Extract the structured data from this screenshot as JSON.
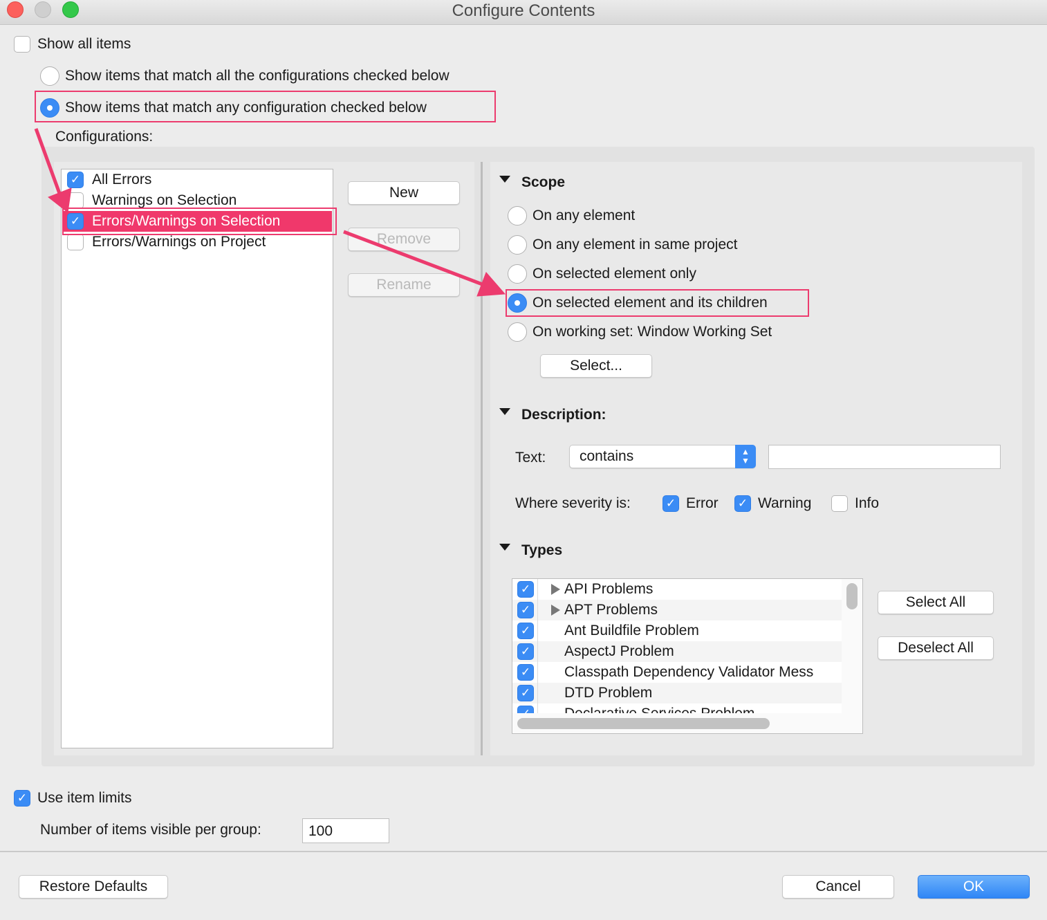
{
  "window": {
    "title": "Configure Contents"
  },
  "show_all": {
    "label": "Show all items",
    "checked": false
  },
  "match_options": [
    {
      "label": "Show items that match all the configurations checked below",
      "selected": false
    },
    {
      "label": "Show items that match any configuration checked below",
      "selected": true
    }
  ],
  "configurations": {
    "label": "Configurations:",
    "items": [
      {
        "label": "All Errors",
        "checked": true,
        "selected": false
      },
      {
        "label": "Warnings on Selection",
        "checked": false,
        "selected": false
      },
      {
        "label": "Errors/Warnings on Selection",
        "checked": true,
        "selected": true
      },
      {
        "label": "Errors/Warnings on Project",
        "checked": false,
        "selected": false
      }
    ],
    "buttons": {
      "new": "New",
      "remove": "Remove",
      "rename": "Rename"
    }
  },
  "scope": {
    "heading": "Scope",
    "options": [
      {
        "label": "On any element",
        "selected": false
      },
      {
        "label": "On any element in same project",
        "selected": false
      },
      {
        "label": "On selected element only",
        "selected": false
      },
      {
        "label": "On selected element and its children",
        "selected": true
      },
      {
        "label": "On working set:  Window Working Set",
        "selected": false
      }
    ],
    "select_button": "Select..."
  },
  "description": {
    "heading": "Description:",
    "text_label": "Text:",
    "operator": "contains",
    "text_value": "",
    "severity_label": "Where severity is:",
    "severities": [
      {
        "label": "Error",
        "checked": true
      },
      {
        "label": "Warning",
        "checked": true
      },
      {
        "label": "Info",
        "checked": false
      }
    ]
  },
  "types": {
    "heading": "Types",
    "items": [
      {
        "label": "API Problems",
        "checked": true,
        "expandable": true
      },
      {
        "label": "APT Problems",
        "checked": true,
        "expandable": true
      },
      {
        "label": "Ant Buildfile Problem",
        "checked": true,
        "expandable": false
      },
      {
        "label": "AspectJ Problem",
        "checked": true,
        "expandable": false
      },
      {
        "label": "Classpath Dependency Validator Mess",
        "checked": true,
        "expandable": false
      },
      {
        "label": "DTD Problem",
        "checked": true,
        "expandable": false
      },
      {
        "label": "Declarative Services Problem",
        "checked": true,
        "expandable": false
      }
    ],
    "select_all": "Select All",
    "deselect_all": "Deselect All"
  },
  "limits": {
    "label": "Use item limits",
    "checked": true,
    "count_label": "Number of items visible per group:",
    "count_value": "100"
  },
  "footer": {
    "restore": "Restore Defaults",
    "cancel": "Cancel",
    "ok": "OK"
  },
  "colors": {
    "accent": "#3b8cf5",
    "annotation": "#ec3b6e",
    "selection": "#f0386b"
  }
}
